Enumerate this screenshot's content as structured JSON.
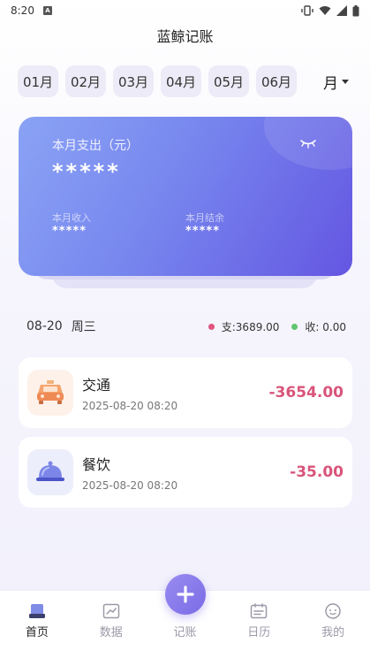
{
  "status_bar": {
    "time": "8:20",
    "app_badge": "A"
  },
  "header": {
    "title": "蓝鲸记账"
  },
  "months": [
    "01月",
    "02月",
    "03月",
    "04月",
    "05月",
    "06月"
  ],
  "period": {
    "selected": "月"
  },
  "summary": {
    "expense_label": "本月支出（元）",
    "expense_value": "*****",
    "income_label": "本月收入",
    "income_value": "*****",
    "balance_label": "本月结余",
    "balance_value": "*****"
  },
  "day": {
    "date": "08-20",
    "weekday": "周三",
    "expense": "支:3689.00",
    "income": "收: 0.00"
  },
  "transactions": [
    {
      "title": "交通",
      "time": "2025-08-20 08:20",
      "amount": "-3654.00",
      "icon": "car-icon"
    },
    {
      "title": "餐饮",
      "time": "2025-08-20 08:20",
      "amount": "-35.00",
      "icon": "dining-cloche-icon"
    }
  ],
  "nav": {
    "home": "首页",
    "data": "数据",
    "record": "记账",
    "calendar": "日历",
    "mine": "我的"
  },
  "colors": {
    "accent": "#7a6be6",
    "expense": "#d9547a",
    "income_dot": "#5fc46e",
    "expense_dot": "#e0547e"
  }
}
